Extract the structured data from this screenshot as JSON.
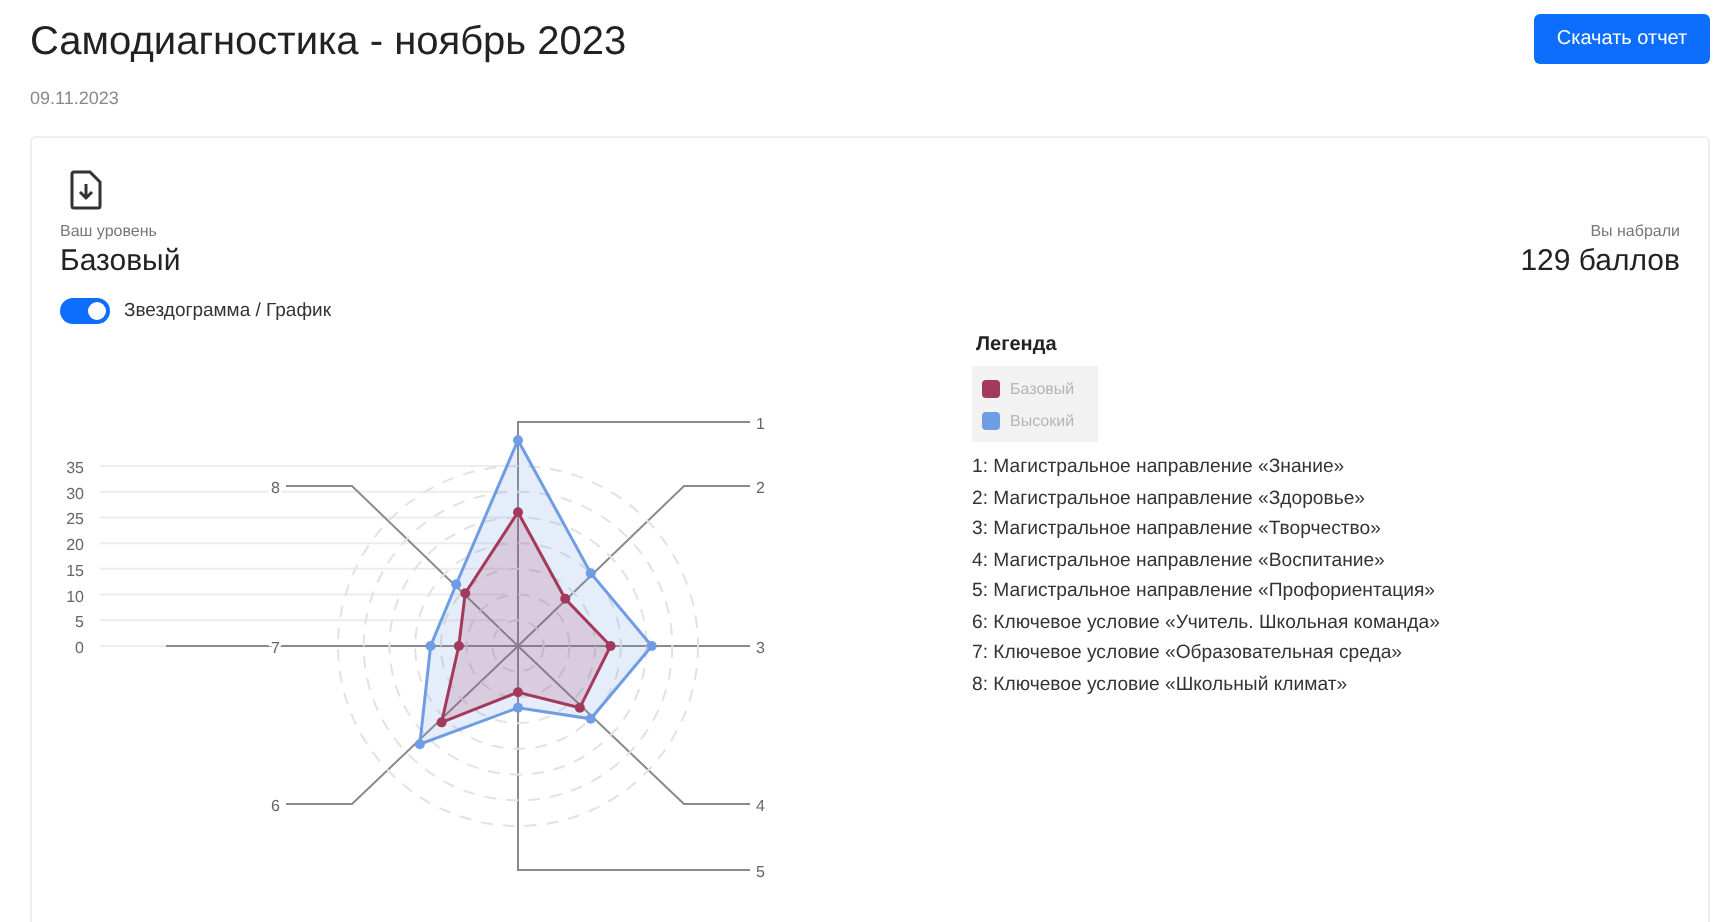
{
  "header": {
    "title": "Самодиагностика - ноябрь 2023",
    "date": "09.11.2023",
    "download_button": "Скачать отчет"
  },
  "summary": {
    "level_label": "Ваш уровень",
    "level": "Базовый",
    "score_label": "Вы набрали",
    "score": "129 баллов"
  },
  "view_toggle": {
    "label": "Звездограмма / График",
    "on": true
  },
  "chart": {
    "scale_labels": [
      "35",
      "30",
      "25",
      "20",
      "15",
      "10",
      "5",
      "0"
    ],
    "axis_labels": [
      "1",
      "8",
      "2",
      "7",
      "3",
      "6",
      "4",
      "5"
    ]
  },
  "legend": {
    "title": "Легенда",
    "series": [
      {
        "label": "Базовый",
        "color": "#a33a5c"
      },
      {
        "label": "Высокий",
        "color": "#6f9de3"
      }
    ],
    "items": [
      "1: Магистральное направление «Знание»",
      "2: Магистральное направление «Здоровье»",
      "3: Магистральное направление «Творчество»",
      "4: Магистральное направление «Воспитание»",
      "5: Магистральное направление «Профориентация»",
      "6: Ключевое условие «Учитель. Школьная команда»",
      "7: Ключевое условие «Образовательная среда»",
      "8: Ключевое условие «Школьный климат»"
    ]
  }
}
